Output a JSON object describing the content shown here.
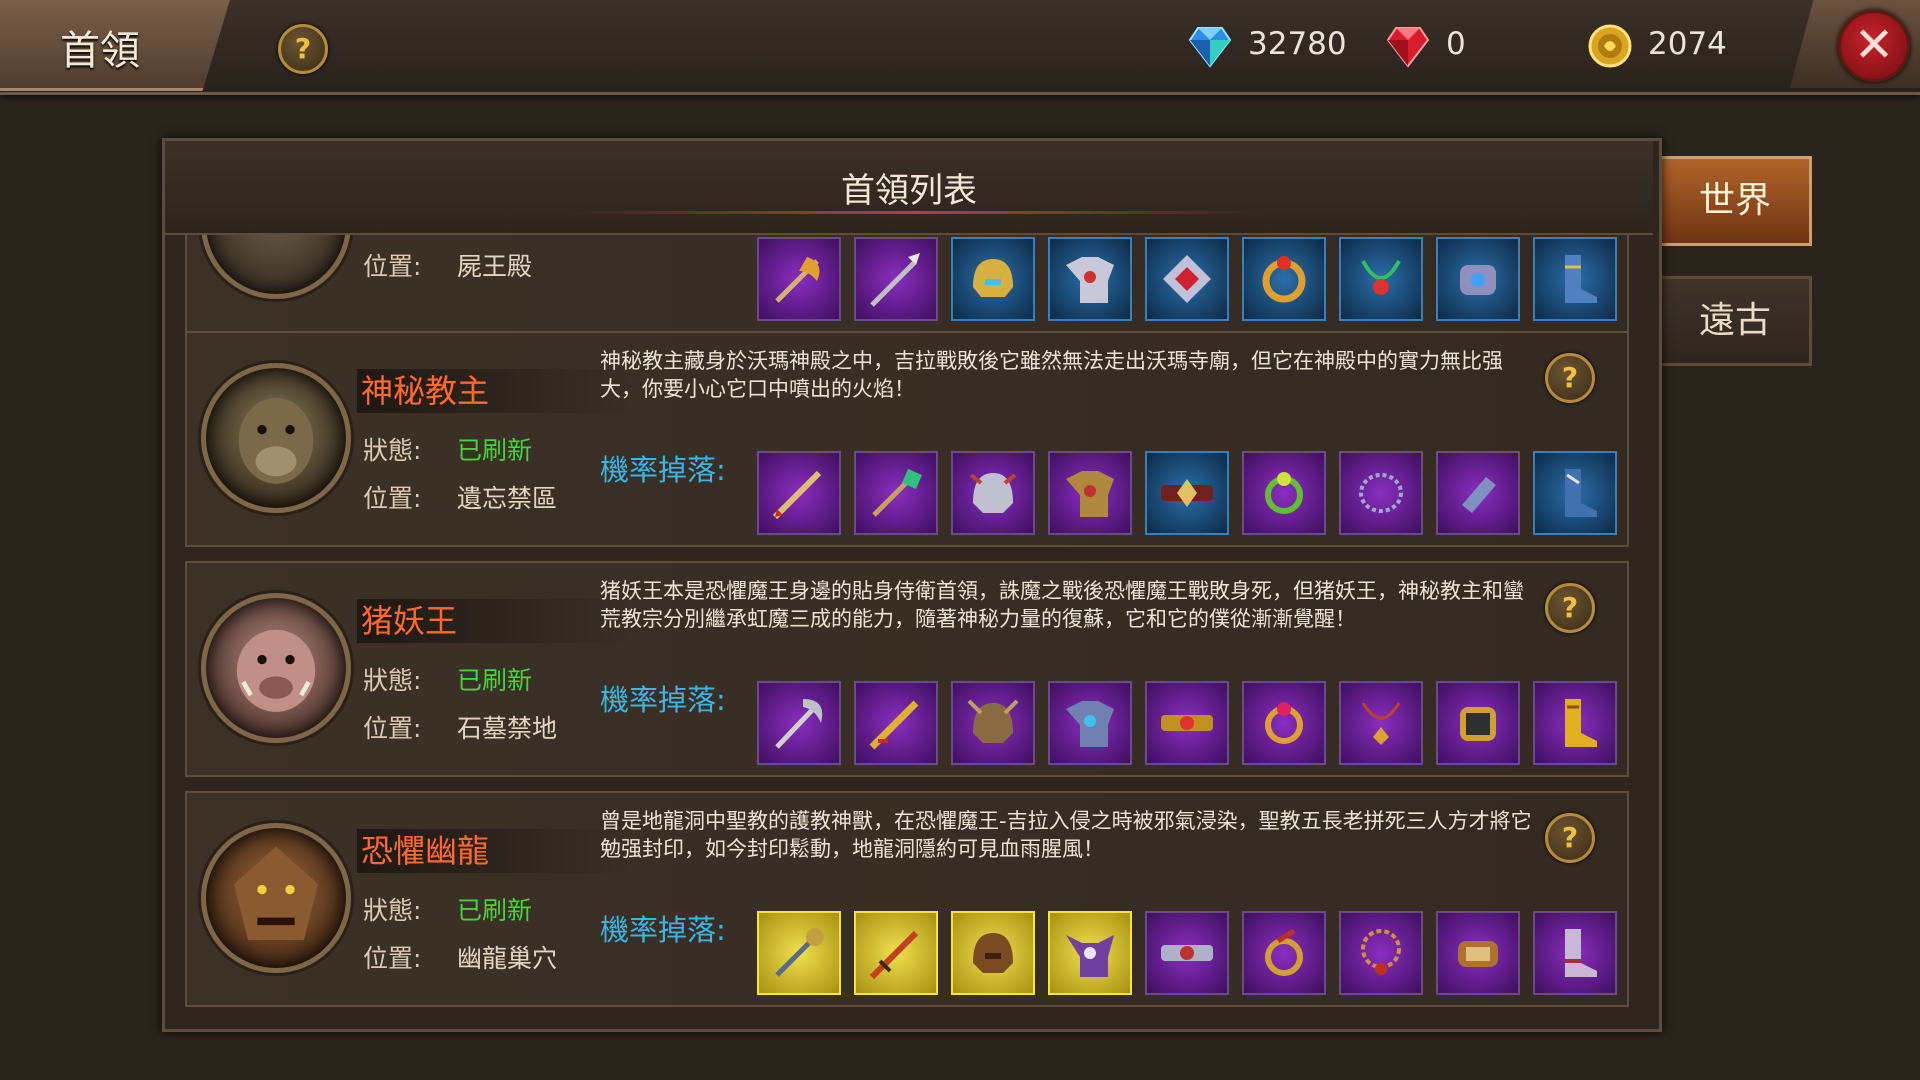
{
  "header": {
    "title": "首領",
    "currencies": [
      {
        "name": "blue-diamond",
        "value": "32780"
      },
      {
        "name": "red-ruby",
        "value": "0"
      },
      {
        "name": "gold-coin",
        "value": "2074"
      }
    ],
    "help_icon": "question-icon",
    "close_icon": "close-icon"
  },
  "panel": {
    "title": "首領列表"
  },
  "side_tabs": [
    {
      "label": "世界",
      "active": true
    },
    {
      "label": "遠古",
      "active": false
    }
  ],
  "labels": {
    "status": "狀態:",
    "location": "位置:",
    "drops": "機率掉落:"
  },
  "bosses": [
    {
      "name": "",
      "status": "",
      "location": "屍王殿",
      "description": "",
      "drops": [
        "purple-axe",
        "purple-spear",
        "blue-helmet",
        "blue-armor",
        "blue-amulet",
        "blue-ring",
        "blue-necklace",
        "blue-bracer",
        "blue-boots"
      ]
    },
    {
      "name": "神秘教主",
      "status": "已刷新",
      "location": "遺忘禁區",
      "description": "神秘教主藏身於沃瑪神殿之中，吉拉戰敗後它雖然無法走出沃瑪寺廟，但它在神殿中的實力無比强大，你要小心它口中噴出的火焰！",
      "drops": [
        "purple-sword",
        "purple-staff",
        "purple-helmet",
        "purple-armor",
        "blue-belt",
        "purple-ring",
        "purple-necklace",
        "purple-bracer",
        "blue-boots"
      ]
    },
    {
      "name": "猪妖王",
      "status": "已刷新",
      "location": "石墓禁地",
      "description": "猪妖王本是恐懼魔王身邊的貼身侍衛首領，誅魔之戰後恐懼魔王戰敗身死，但猪妖王，神秘教主和蠻荒教宗分別繼承虹魔三成的能力，隨著神秘力量的復蘇，它和它的僕從漸漸覺醒！",
      "drops": [
        "purple-scythe",
        "purple-blade",
        "purple-helmet",
        "purple-armor",
        "purple-belt",
        "purple-ring",
        "purple-necklace",
        "purple-bracer",
        "purple-boots"
      ]
    },
    {
      "name": "恐懼幽龍",
      "status": "已刷新",
      "location": "幽龍巢穴",
      "description": "曾是地龍洞中聖教的護教神獸，在恐懼魔王-吉拉入侵之時被邪氣浸染，聖教五長老拼死三人方才將它勉强封印，如今封印鬆動，地龍洞隱約可見血雨腥風！",
      "drops": [
        "gold-staff",
        "gold-sword",
        "gold-helmet",
        "gold-armor",
        "purple-belt",
        "purple-ring",
        "purple-necklace",
        "purple-bracer",
        "purple-boots"
      ]
    }
  ],
  "colors": {
    "boss_name": "#ff6a2a",
    "status_refreshed": "#45d43a",
    "drop_label": "#39b6e6",
    "rarity_purple": "#8a2ec0",
    "rarity_blue": "#2a6fa8",
    "rarity_gold": "#f0e050"
  }
}
